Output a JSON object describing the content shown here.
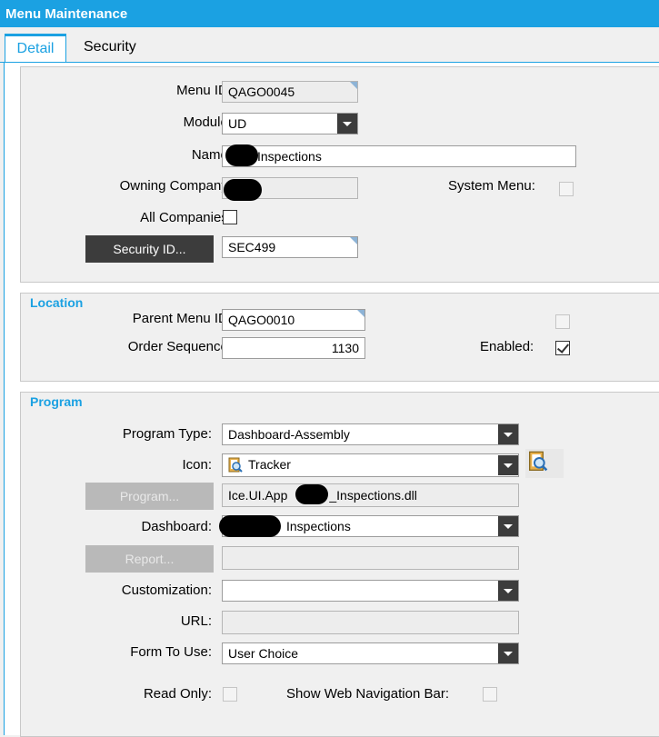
{
  "window": {
    "title": "Menu Maintenance"
  },
  "tabs": [
    {
      "label": "Detail"
    },
    {
      "label": "Security"
    }
  ],
  "detail": {
    "menu_id_label": "Menu ID:",
    "menu_id": "QAGO0045",
    "module_label": "Module:",
    "module": "UD",
    "name_label": "Name:",
    "name": "Inspections",
    "owning_company_label": "Owning Company:",
    "system_menu_label": "System Menu:",
    "all_companies_label": "All Companies:",
    "security_button": "Security ID...",
    "security_id": "SEC499"
  },
  "location": {
    "title": "Location",
    "parent_menu_label": "Parent Menu ID:",
    "parent_menu_id": "QAGO0010",
    "order_label": "Order Sequence:",
    "order_sequence": "1130",
    "enabled_label": "Enabled:"
  },
  "program": {
    "title": "Program",
    "type_label": "Program Type:",
    "type": "Dashboard-Assembly",
    "icon_label": "Icon:",
    "icon": "Tracker",
    "program_button": "Program...",
    "program_value_prefix": "Ice.UI.App",
    "program_value_suffix": "_Inspections.dll",
    "dashboard_label": "Dashboard:",
    "dashboard": "Inspections",
    "report_button": "Report...",
    "customization_label": "Customization:",
    "url_label": "URL:",
    "form_label": "Form To Use:",
    "form": "User Choice",
    "readonly_label": "Read Only:",
    "webnav_label": "Show Web Navigation Bar:"
  },
  "colors": {
    "accent": "#1ba1e2",
    "button": "#3c3c3c"
  }
}
